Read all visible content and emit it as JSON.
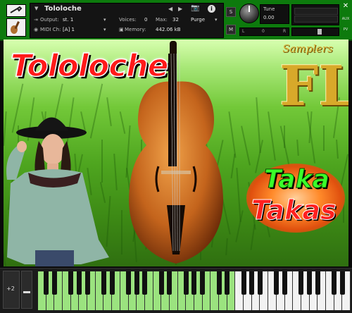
{
  "header": {
    "instrument_name": "Tololoche",
    "output_label": "Output:",
    "output_value": "st. 1",
    "voices_label": "Voices:",
    "voices_value": "0",
    "max_label": "Max:",
    "max_value": "32",
    "purge_label": "Purge",
    "midi_label": "MIDI Ch:",
    "midi_value": "[A] 1",
    "memory_label": "Memory:",
    "memory_value": "442.06 kB",
    "solo_label": "S",
    "mute_label": "M",
    "tune_label": "Tune",
    "tune_value": "0.00",
    "pan_label": "L",
    "pan_center": "0",
    "pan_right": "R",
    "aux_label": "AUX",
    "pv_label": "PV"
  },
  "art": {
    "title": "Tololoche",
    "brand_script": "Samplers",
    "brand_monogram": "FL",
    "badge_line1": "Taka",
    "badge_line2": "Takas"
  },
  "keyboard": {
    "octave_label": "+2",
    "white_key_count": 38,
    "highlight_white_count": 24,
    "highlight_color": "#9be37f"
  },
  "colors": {
    "header_green": "#0d7a0d",
    "title_red": "#ff1a1a",
    "taka_green": "#3aff2a",
    "gold": "#d8a92a"
  }
}
